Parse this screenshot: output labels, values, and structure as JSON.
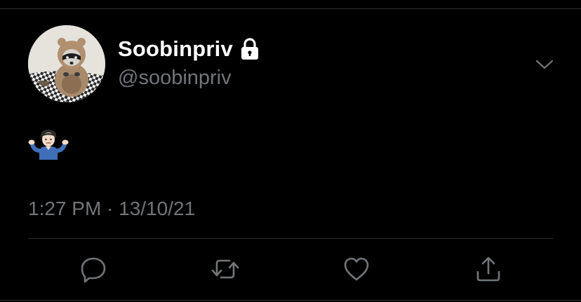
{
  "tweet": {
    "author": {
      "display_name": "Soobinpriv",
      "handle": "@soobinpriv",
      "protected_icon": "lock-icon",
      "avatar": "raccoon-avatar"
    },
    "body_emoji": "🤷🏻‍♂️",
    "timestamp": "1:27 PM · 13/10/21",
    "menu_icon": "chevron-down-icon",
    "actions": [
      {
        "name": "reply",
        "icon": "speech-bubble-icon"
      },
      {
        "name": "retweet",
        "icon": "retweet-arrows-icon"
      },
      {
        "name": "like",
        "icon": "heart-icon"
      },
      {
        "name": "share",
        "icon": "share-upload-icon"
      }
    ]
  },
  "colors": {
    "background": "#000000",
    "primary_text": "#ffffff",
    "secondary_text": "#71767b",
    "divider": "#2f3336"
  }
}
